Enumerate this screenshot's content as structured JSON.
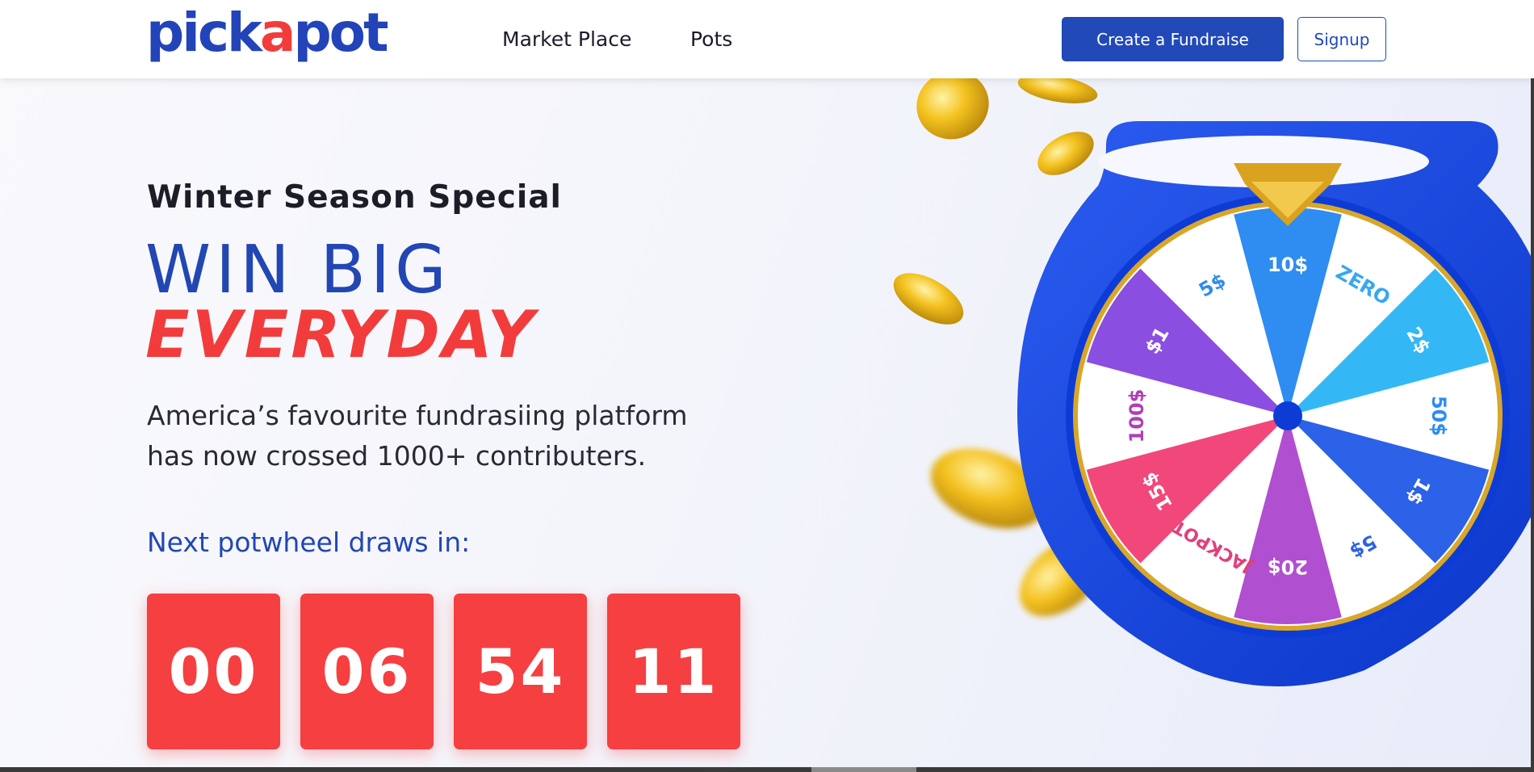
{
  "brand": {
    "logo_prefix": "pick",
    "logo_accent": "a",
    "logo_suffix": "pot",
    "primary_color": "#2247b3",
    "accent_color": "#f23c3c"
  },
  "nav": {
    "links": [
      "Market Place",
      "Pots"
    ],
    "create_label": "Create a Fundraise",
    "signup_label": "Signup"
  },
  "hero": {
    "subtitle": "Winter Season Special",
    "title_line1": "WIN BIG",
    "title_line2": "EVERYDAY",
    "description_line1": "America’s favourite fundrasiing platform",
    "description_line2": "has now crossed 1000+ contributers."
  },
  "countdown": {
    "label": "Next potwheel draws in:",
    "values": [
      "00",
      "06",
      "54",
      "11"
    ]
  },
  "wheel": {
    "segments": [
      "10$",
      "ZERO",
      "2$",
      "50$",
      "1$",
      "5$",
      "20$",
      "JACKPOT",
      "15$",
      "100$",
      "$1",
      "5$"
    ]
  }
}
